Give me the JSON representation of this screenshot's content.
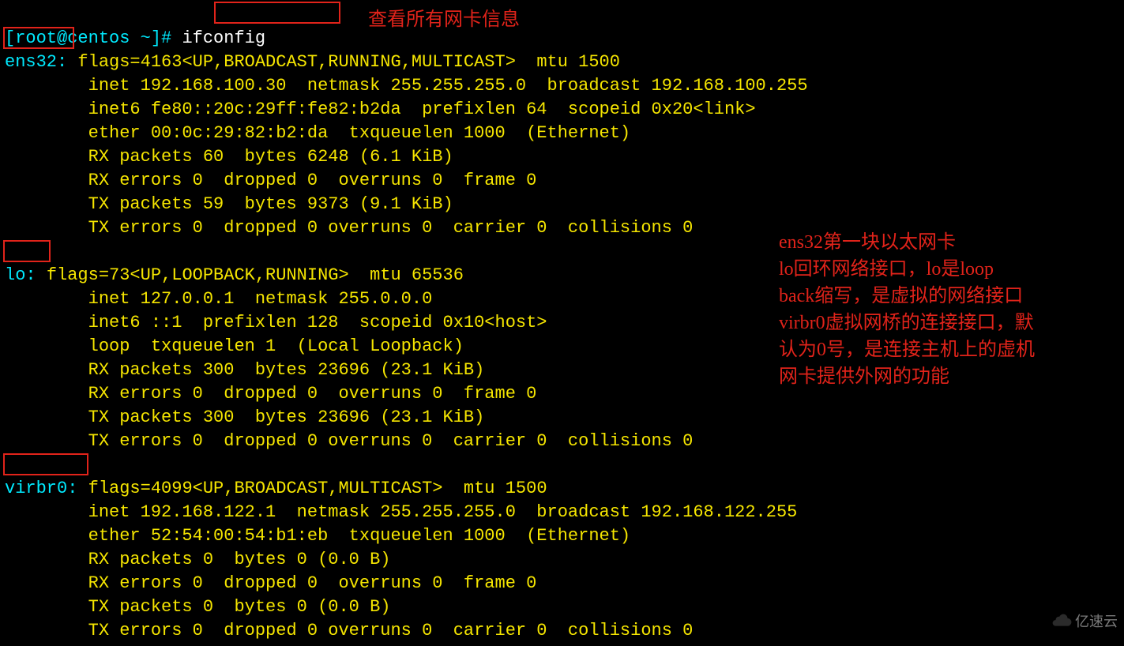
{
  "prompt_user": "[root@centos ~]#",
  "command": "ifconfig",
  "note_cmd": "查看所有网卡信息",
  "watermark": "亿速云",
  "ens32": {
    "name": "ens32:",
    "l1a": "flags=4163<UP,BROADCAST,RUNNING,MULTICAST>  mtu 1500",
    "l2": "        inet 192.168.100.30  netmask 255.255.255.0  broadcast 192.168.100.255",
    "l3": "        inet6 fe80::20c:29ff:fe82:b2da  prefixlen 64  scopeid 0x20<link>",
    "l4": "        ether 00:0c:29:82:b2:da  txqueuelen 1000  (Ethernet)",
    "l5": "        RX packets 60  bytes 6248 (6.1 KiB)",
    "l6": "        RX errors 0  dropped 0  overruns 0  frame 0",
    "l7": "        TX packets 59  bytes 9373 (9.1 KiB)",
    "l8": "        TX errors 0  dropped 0 overruns 0  carrier 0  collisions 0"
  },
  "lo": {
    "name": "lo:",
    "l1a": "flags=73<UP,LOOPBACK,RUNNING>  mtu 65536",
    "l2": "        inet 127.0.0.1  netmask 255.0.0.0",
    "l3": "        inet6 ::1  prefixlen 128  scopeid 0x10<host>",
    "l4": "        loop  txqueuelen 1  (Local Loopback)",
    "l5": "        RX packets 300  bytes 23696 (23.1 KiB)",
    "l6": "        RX errors 0  dropped 0  overruns 0  frame 0",
    "l7": "        TX packets 300  bytes 23696 (23.1 KiB)",
    "l8": "        TX errors 0  dropped 0 overruns 0  carrier 0  collisions 0"
  },
  "virbr0": {
    "name": "virbr0:",
    "l1a": "flags=4099<UP,BROADCAST,MULTICAST>  mtu 1500",
    "l2": "        inet 192.168.122.1  netmask 255.255.255.0  broadcast 192.168.122.255",
    "l3": "        ether 52:54:00:54:b1:eb  txqueuelen 1000  (Ethernet)",
    "l4": "        RX packets 0  bytes 0 (0.0 B)",
    "l5": "        RX errors 0  dropped 0  overruns 0  frame 0",
    "l6": "        TX packets 0  bytes 0 (0.0 B)",
    "l7": "        TX errors 0  dropped 0 overruns 0  carrier 0  collisions 0"
  },
  "side": {
    "a": "ens32第一块以太网卡",
    "b": "lo回环网络接口，lo是loop",
    "c": "back缩写，是虚拟的网络接口",
    "d": "virbr0虚拟网桥的连接接口，默",
    "e": "认为0号，是连接主机上的虚机",
    "f": "网卡提供外网的功能"
  }
}
